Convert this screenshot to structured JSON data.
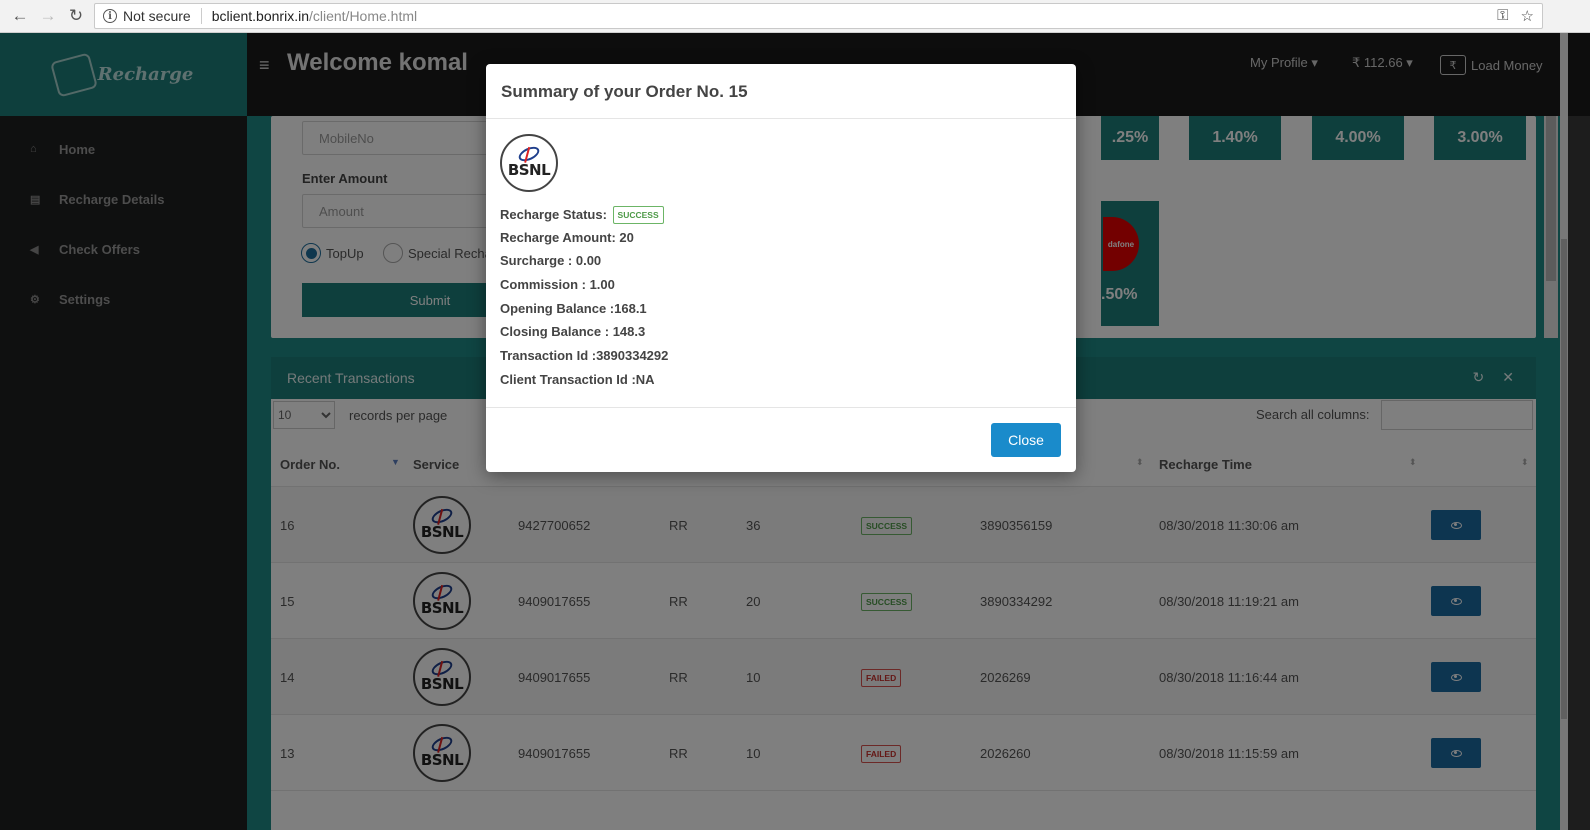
{
  "browser": {
    "security": "Not secure",
    "host": "bclient.bonrix.in",
    "path": "/client/Home.html"
  },
  "brand": {
    "name": "Recharge"
  },
  "topbar": {
    "welcome": "Welcome komal",
    "profile": "My Profile ▾",
    "balance": "₹ 112.66 ▾",
    "load_money": "Load Money",
    "wallet_symbol": "₹"
  },
  "sidebar": {
    "items": [
      {
        "label": "Home",
        "icon": "home-icon"
      },
      {
        "label": "Recharge Details",
        "icon": "book-icon"
      },
      {
        "label": "Check Offers",
        "icon": "bullhorn-icon"
      },
      {
        "label": "Settings",
        "icon": "cogs-icon"
      }
    ]
  },
  "form": {
    "mobile_placeholder": "MobileNo",
    "amount_label": "Enter Amount",
    "amount_placeholder": "Amount",
    "radio_topup": "TopUp",
    "radio_special": "Special Recha",
    "submit": "Submit"
  },
  "offers": {
    "tiles": [
      ".25%",
      "1.40%",
      "4.00%",
      "3.00%"
    ],
    "vodafone_pct": ".50%",
    "vodafone_text": "dafone"
  },
  "transactions": {
    "title": "Recent Transactions",
    "per_page": "10",
    "records_label": "records per page",
    "search_label": "Search all columns:",
    "headers": [
      "Order No.",
      "Service",
      "Recharge Time"
    ],
    "rows": [
      {
        "order": "16",
        "logo": "BSNL",
        "mobile": "9427700652",
        "type": "RR",
        "amount": "36",
        "status": "SUCCESS",
        "txid": "3890356159",
        "time": "08/30/2018 11:30:06 am"
      },
      {
        "order": "15",
        "logo": "BSNL",
        "mobile": "9409017655",
        "type": "RR",
        "amount": "20",
        "status": "SUCCESS",
        "txid": "3890334292",
        "time": "08/30/2018 11:19:21 am"
      },
      {
        "order": "14",
        "logo": "BSNL",
        "mobile": "9409017655",
        "type": "RR",
        "amount": "10",
        "status": "FAILED",
        "txid": "2026269",
        "time": "08/30/2018 11:16:44 am"
      },
      {
        "order": "13",
        "logo": "BSNL",
        "mobile": "9409017655",
        "type": "RR",
        "amount": "10",
        "status": "FAILED",
        "txid": "2026260",
        "time": "08/30/2018 11:15:59 am"
      }
    ]
  },
  "modal": {
    "title": "Summary of your Order No. 15",
    "logo": "BSNL",
    "status_label": "Recharge Status:",
    "status": "SUCCESS",
    "amount": "Recharge Amount: 20",
    "surcharge": "Surcharge : 0.00",
    "commission": "Commission : 1.00",
    "opening": "Opening Balance :168.1",
    "closing": "Closing Balance : 148.3",
    "txid": "Transaction Id :3890334292",
    "client_txid": "Client Transaction Id :NA",
    "close": "Close"
  }
}
